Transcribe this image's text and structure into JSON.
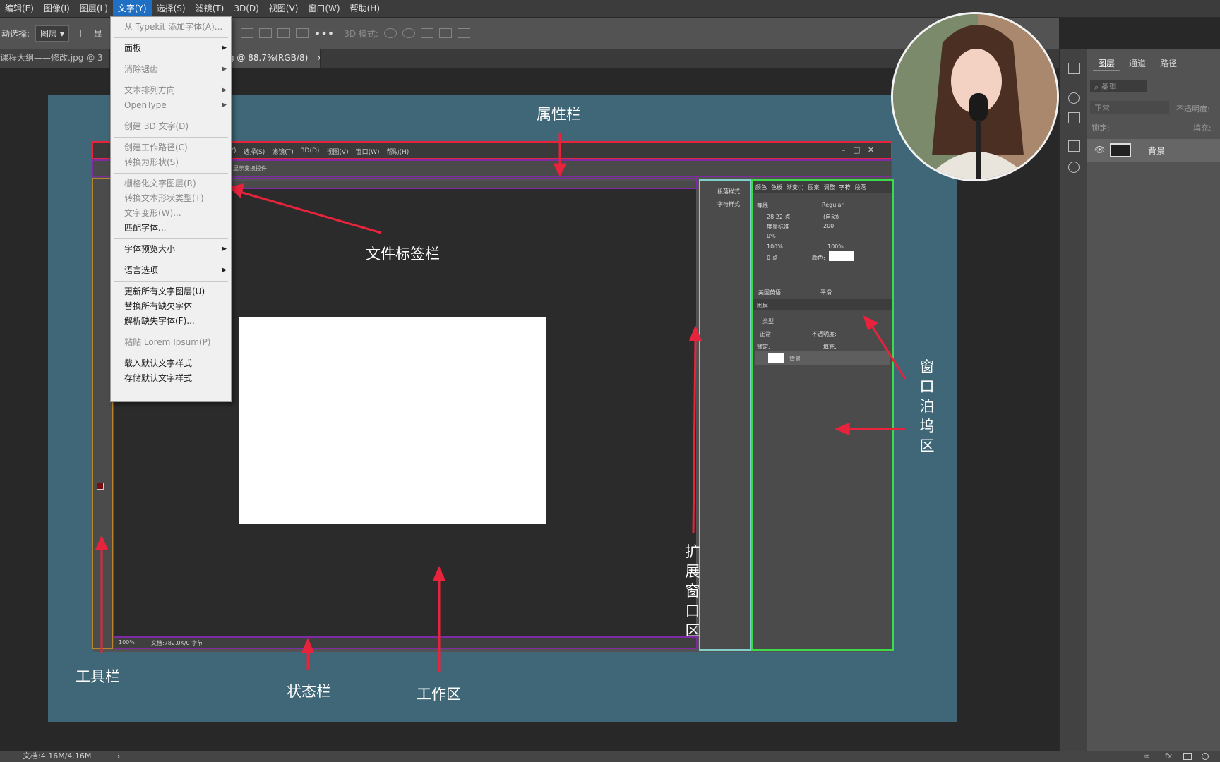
{
  "menubar": {
    "items": [
      "编辑(E)",
      "图像(I)",
      "图层(L)",
      "文字(Y)",
      "选择(S)",
      "滤镜(T)",
      "3D(D)",
      "视图(V)",
      "窗口(W)",
      "帮助(H)"
    ]
  },
  "optionsbar": {
    "auto_select": "动选择:",
    "layer_select": "图层",
    "show_prefix": "显",
    "mode3d": "3D 模式:"
  },
  "tabs": {
    "tab1": "课程大纲——修改.jpg @ 3",
    "tab2": "g @ 88.7%(RGB/8)",
    "close": "×"
  },
  "dropdown": [
    {
      "label": "从 Typekit 添加字体(A)...",
      "disabled": true,
      "submenu": false
    },
    {
      "sep": true
    },
    {
      "label": "面板",
      "disabled": false,
      "submenu": true
    },
    {
      "sep": true
    },
    {
      "label": "消除锯齿",
      "disabled": true,
      "submenu": true
    },
    {
      "sep": true
    },
    {
      "label": "文本排列方向",
      "disabled": true,
      "submenu": true
    },
    {
      "label": "OpenType",
      "disabled": true,
      "submenu": true
    },
    {
      "sep": true
    },
    {
      "label": "创建 3D 文字(D)",
      "disabled": true,
      "submenu": false
    },
    {
      "sep": true
    },
    {
      "label": "创建工作路径(C)",
      "disabled": true,
      "submenu": false
    },
    {
      "label": "转换为形状(S)",
      "disabled": true,
      "submenu": false
    },
    {
      "sep": true
    },
    {
      "label": "栅格化文字图层(R)",
      "disabled": true,
      "submenu": false
    },
    {
      "label": "转换文本形状类型(T)",
      "disabled": true,
      "submenu": false
    },
    {
      "label": "文字变形(W)...",
      "disabled": true,
      "submenu": false
    },
    {
      "label": "匹配字体...",
      "disabled": false,
      "submenu": false
    },
    {
      "sep": true
    },
    {
      "label": "字体预览大小",
      "disabled": false,
      "submenu": true
    },
    {
      "sep": true
    },
    {
      "label": "语言选项",
      "disabled": false,
      "submenu": true
    },
    {
      "sep": true
    },
    {
      "label": "更新所有文字图层(U)",
      "disabled": false,
      "submenu": false
    },
    {
      "label": "替换所有缺欠字体",
      "disabled": false,
      "submenu": false
    },
    {
      "label": "解析缺失字体(F)...",
      "disabled": false,
      "submenu": false
    },
    {
      "sep": true
    },
    {
      "label": "粘贴 Lorem Ipsum(P)",
      "disabled": true,
      "submenu": false
    },
    {
      "sep": true
    },
    {
      "label": "载入默认文字样式",
      "disabled": false,
      "submenu": false
    },
    {
      "label": "存储默认文字样式",
      "disabled": false,
      "submenu": false
    }
  ],
  "annotations": {
    "attribute_bar": "属性栏",
    "file_tab_bar": "文件标签栏",
    "toolbar": "工具栏",
    "status_bar": "状态栏",
    "work_area": "工作区",
    "expand_window": [
      "扩",
      "展",
      "窗",
      "口",
      "区"
    ],
    "dock_window": [
      "窗",
      "口",
      "泊",
      "坞",
      "区"
    ]
  },
  "inner": {
    "menus": [
      "(Y)",
      "选择(S)",
      "滤镜(T)",
      "3D(D)",
      "视图(V)",
      "窗口(W)",
      "帮助(H)"
    ],
    "show_transform": "显示变换控件",
    "zoom": "100%",
    "doc": "文档:782.0K/0 字节",
    "para_style": "段落样式",
    "char_style": "字符样式",
    "panel_tabs": [
      "颜色",
      "色板",
      "渐变(I)",
      "图案",
      "调整",
      "字符",
      "段落"
    ],
    "font": "等线",
    "font_style": "Regular",
    "font_size": "28.22 点",
    "leading": "(自动)",
    "kerning": "度量标准",
    "tracking": "200",
    "scale_pct": "0%",
    "vscale": "100%",
    "hscale": "100%",
    "baseline": "0 点",
    "color_label": "颜色:",
    "language": "美国英语",
    "aa": "平滑",
    "layers_tab": "图层",
    "layer_kind": "类型",
    "layer_mode": "正常",
    "opacity": "不透明度:",
    "lock": "锁定:",
    "fill": "填充:",
    "layer_name": "背景"
  },
  "rightpanel": {
    "tabs": [
      "图层",
      "通道",
      "路径"
    ],
    "kind": "类型",
    "mode": "正常",
    "opacity": "不透明度:",
    "lock": "锁定:",
    "fill": "填充:",
    "layer_name": "背景"
  },
  "statusbar": {
    "doc": "文档:4.16M/4.16M",
    "arrow": "›"
  },
  "colors": {
    "teal": "#3f6778",
    "red": "#e8233c",
    "green": "#3ddb4b",
    "purple": "#7d2aa3"
  }
}
